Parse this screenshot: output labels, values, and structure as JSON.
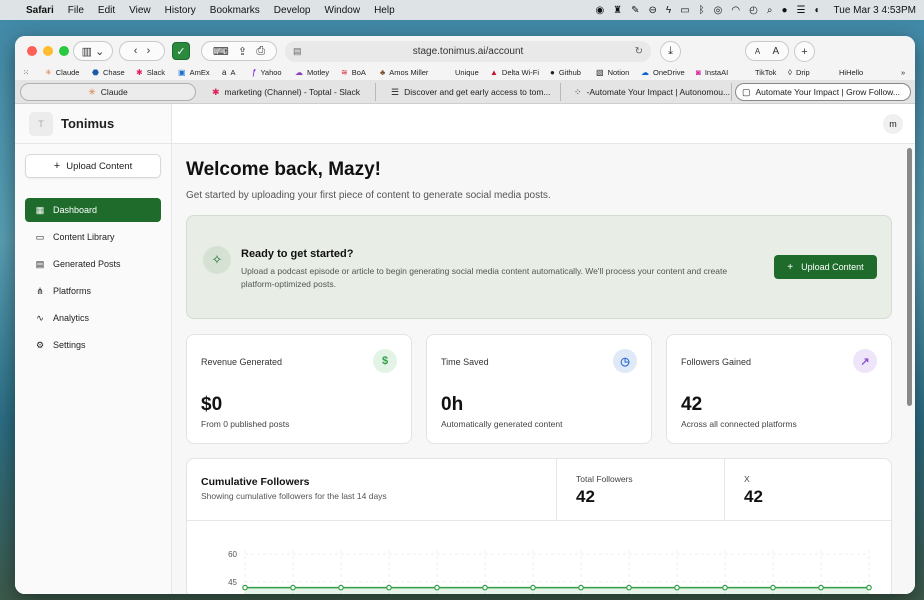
{
  "menubar": {
    "app": "Safari",
    "items": [
      "File",
      "Edit",
      "View",
      "History",
      "Bookmarks",
      "Develop",
      "Window",
      "Help"
    ],
    "clock": "Tue Mar 3  4:53PM"
  },
  "browser": {
    "url": "stage.tonimus.ai/account",
    "text_size_small": "A",
    "text_size_large": "A",
    "bookmarks": [
      "Claude",
      "Chase",
      "Slack",
      "AmEx",
      "A",
      "Yahoo",
      "Motley",
      "BoA",
      "Amos Miller",
      "Unique",
      "Delta Wi-Fi",
      "Github",
      "Notion",
      "OneDrive",
      "InstaAI",
      "TikTok",
      "Drip",
      "HiHello"
    ],
    "tabs": [
      {
        "label": "Claude",
        "icon": "claude-icon"
      },
      {
        "label": "marketing (Channel) - Toptal - Slack",
        "icon": "slack-icon"
      },
      {
        "label": "Discover and get early access to tom...",
        "icon": "document-icon"
      },
      {
        "label": "-Automate Your Impact | Autonomou...",
        "icon": "page-icon"
      },
      {
        "label": "Automate Your Impact | Grow Follow...",
        "icon": "page-icon"
      }
    ]
  },
  "app": {
    "brand_logo": "T",
    "brand_name": "Tonimus",
    "avatar": "m",
    "sidebar_upload": "Upload Content",
    "nav": [
      {
        "label": "Dashboard",
        "icon": "grid-icon",
        "active": true
      },
      {
        "label": "Content Library",
        "icon": "file-icon",
        "active": false
      },
      {
        "label": "Generated Posts",
        "icon": "document-icon",
        "active": false
      },
      {
        "label": "Platforms",
        "icon": "share-icon",
        "active": false
      },
      {
        "label": "Analytics",
        "icon": "analytics-icon",
        "active": false
      },
      {
        "label": "Settings",
        "icon": "gear-icon",
        "active": false
      }
    ]
  },
  "main": {
    "title": "Welcome back, Mazy!",
    "subtitle": "Get started by uploading your first piece of content to generate social media posts.",
    "banner": {
      "title": "Ready to get started?",
      "text": "Upload a podcast episode or article to begin generating social media content automatically. We'll process your content and create platform-optimized posts.",
      "button": "Upload Content"
    },
    "stats": [
      {
        "label": "Revenue Generated",
        "value": "$0",
        "sub": "From 0 published posts",
        "icon": "dollar-icon",
        "icon_glyph": "$",
        "icon_color": "#2f9e44",
        "icon_bg": "#e3f4e6"
      },
      {
        "label": "Time Saved",
        "value": "0h",
        "sub": "Automatically generated content",
        "icon": "clock-icon",
        "icon_glyph": "◷",
        "icon_color": "#2f6fd0",
        "icon_bg": "#dfe9f8"
      },
      {
        "label": "Followers Gained",
        "value": "42",
        "sub": "Across all connected platforms",
        "icon": "trending-up-icon",
        "icon_glyph": "↗",
        "icon_color": "#8a4fd0",
        "icon_bg": "#efe5fa"
      }
    ],
    "followers": {
      "title": "Cumulative Followers",
      "subtitle": "Showing cumulative followers for the last 14 days",
      "total_label": "Total Followers",
      "total_value": "42",
      "platform_label": "X",
      "platform_value": "42"
    }
  },
  "chart_data": {
    "type": "area",
    "title": "Cumulative Followers",
    "y_ticks": [
      60,
      45
    ],
    "ylim": [
      0,
      60
    ],
    "grid": true,
    "series": [
      {
        "name": "X",
        "values": [
          42,
          42,
          42,
          42,
          42,
          42,
          42,
          42,
          42,
          42,
          42,
          42,
          42,
          42
        ]
      }
    ],
    "color": "#2f9e44"
  }
}
